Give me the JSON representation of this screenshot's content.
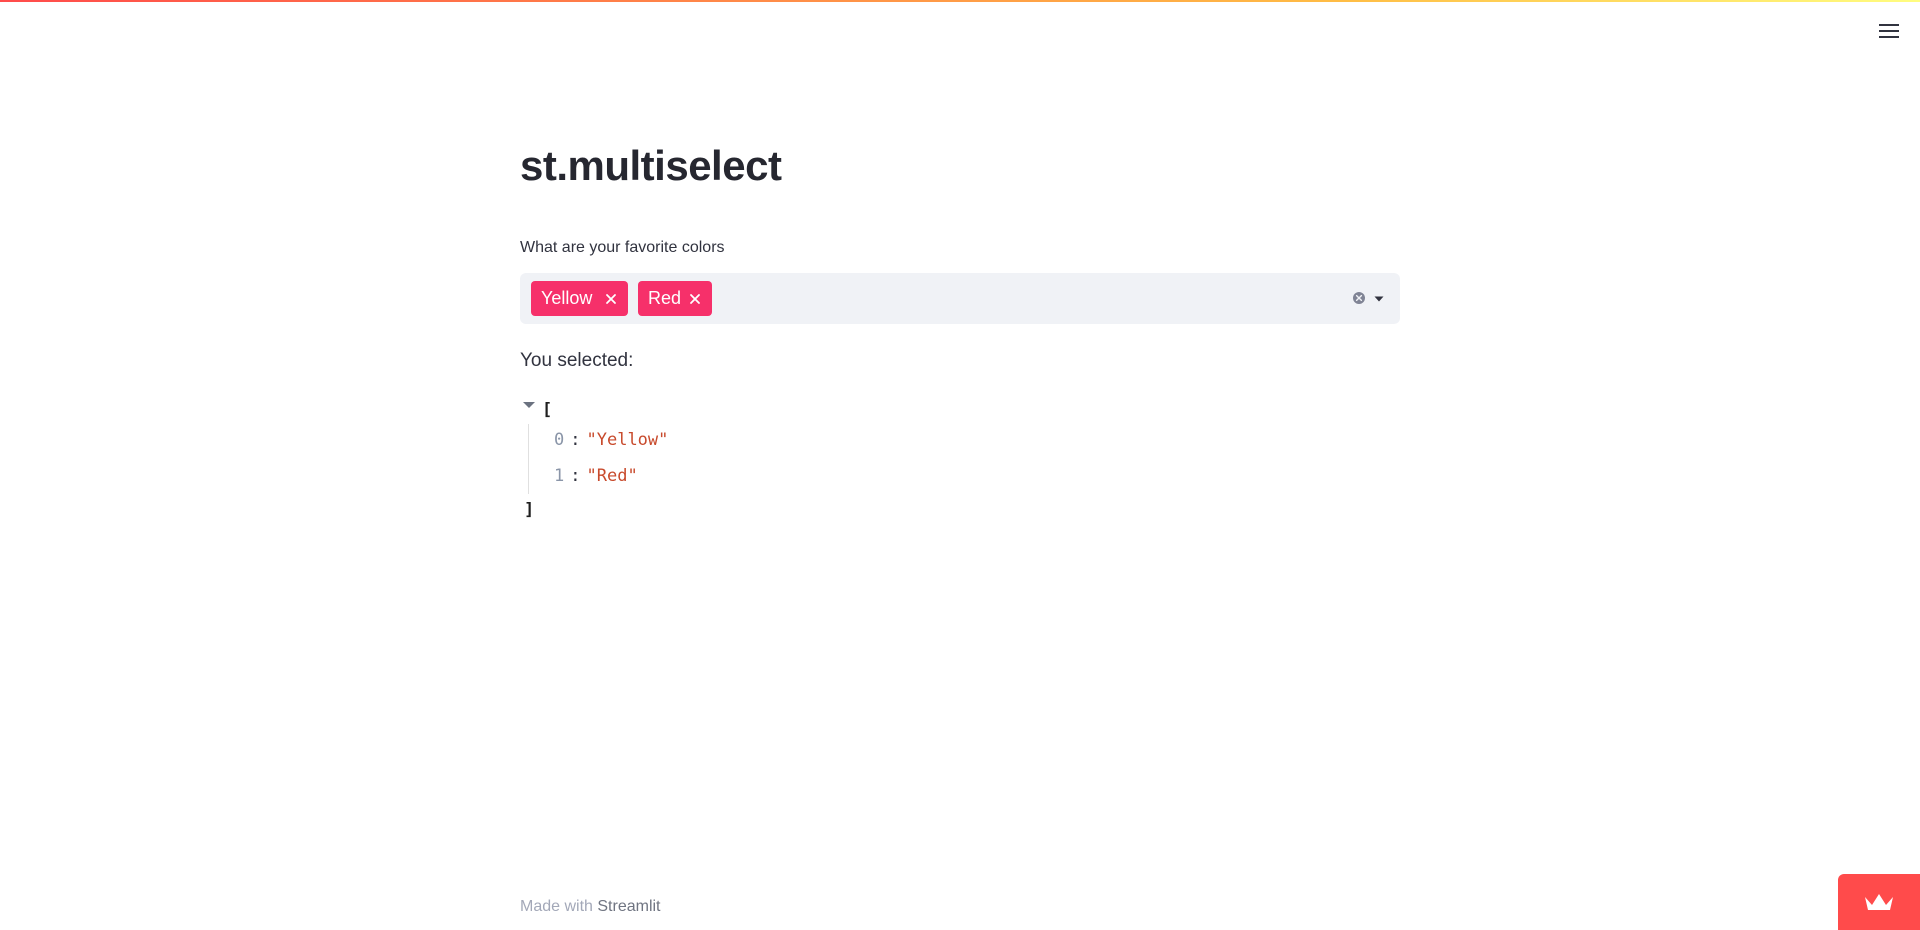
{
  "page": {
    "title": "st.multiselect"
  },
  "header": {
    "menu_icon": "hamburger-menu-icon"
  },
  "multiselect": {
    "label": "What are your favorite colors",
    "selected": [
      {
        "label": "Yellow",
        "remove_icon": "close-icon"
      },
      {
        "label": "Red",
        "remove_icon": "close-icon"
      }
    ],
    "clear_icon": "clear-circle-icon",
    "dropdown_icon": "chevron-down-icon",
    "tag_color": "#f6306a",
    "background": "#f0f2f6"
  },
  "output": {
    "text": "You selected:",
    "json": {
      "open_bracket": "[",
      "close_bracket": "]",
      "items": [
        {
          "index": "0",
          "colon": ":",
          "value": "\"Yellow\""
        },
        {
          "index": "1",
          "colon": ":",
          "value": "\"Red\""
        }
      ]
    }
  },
  "footer": {
    "prefix": "Made with",
    "link": "Streamlit"
  },
  "colors": {
    "accent": "#ff4b4b",
    "string": "#c84a2c",
    "index": "#8a95a8"
  }
}
